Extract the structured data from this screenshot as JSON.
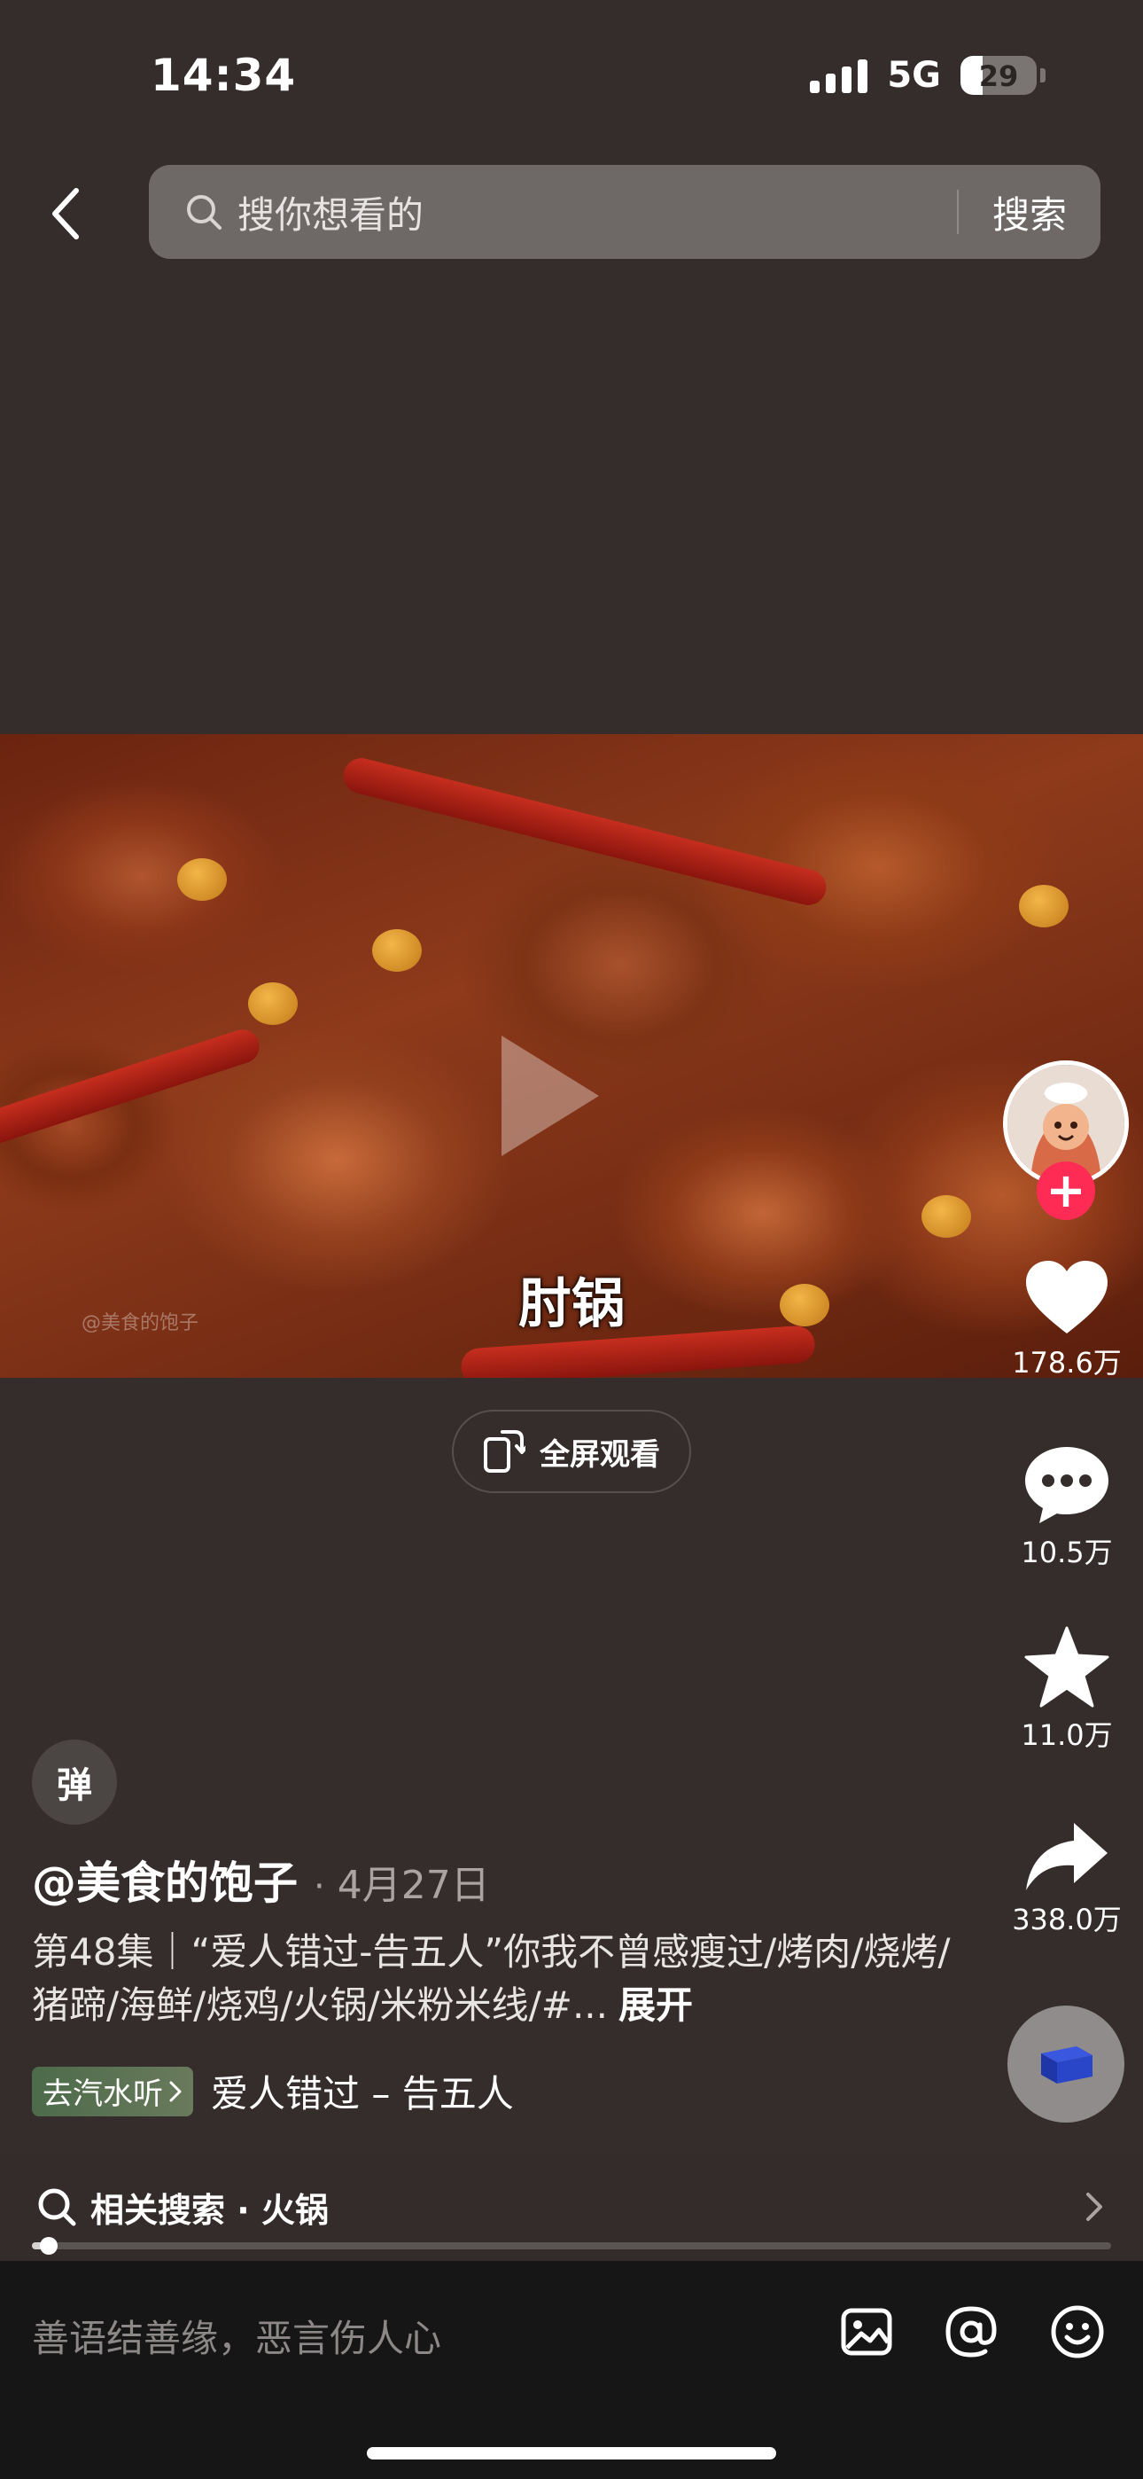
{
  "status_bar": {
    "time": "14:34",
    "network": "5G",
    "battery": "29",
    "battery_level": 0.29
  },
  "search": {
    "placeholder": "搜你想看的",
    "button_label": "搜索"
  },
  "video": {
    "caption": "肘锅",
    "watermark": "@美食的饱子",
    "fullscreen_label": "全屏观看"
  },
  "actions": {
    "likes": "178.6万",
    "comments": "10.5万",
    "favorites": "11.0万",
    "shares": "338.0万"
  },
  "danmaku_label": "弹",
  "post": {
    "author": "@美食的饱子",
    "separator": "·",
    "date": "4月27日",
    "description": "第48集｜“爱人错过-告五人”你我不曾感瘦过/烤肉/烧烤/猪蹄/海鲜/烧鸡/火锅/米粉米线/#...",
    "expand_label": "展开"
  },
  "music": {
    "tag_label": "去汽水听",
    "title": "爱人错过 – 告五人"
  },
  "related_search": {
    "label": "相关搜索 · 火锅"
  },
  "progress": {
    "value": 0.016
  },
  "comment_bar": {
    "placeholder": "善语结善缘，恶言伤人心"
  },
  "colors": {
    "background": "#342d2b",
    "follow_accent": "#fe2c55",
    "comment_bar": "#161616"
  }
}
